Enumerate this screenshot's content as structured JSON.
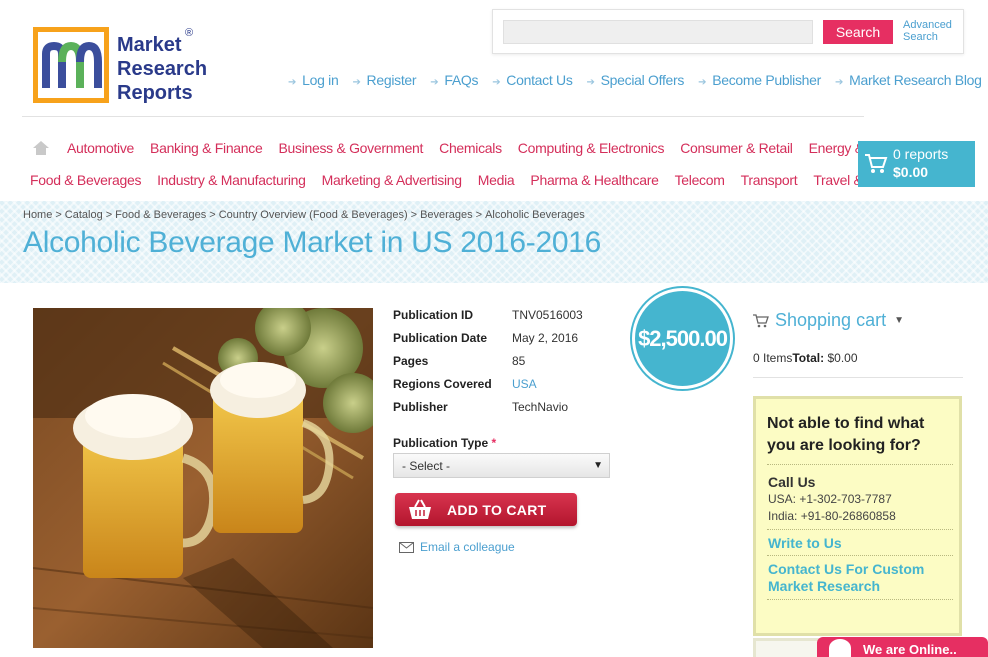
{
  "logo": {
    "line1": "Market",
    "line2": "Research",
    "line3": "Reports",
    "reg": "®"
  },
  "search": {
    "placeholder": "",
    "button_label": "Search",
    "advanced_line1": "Advanced",
    "advanced_line2": "Search"
  },
  "top_links": [
    "Log in",
    "Register",
    "FAQs",
    "Contact Us",
    "Special Offers",
    "Become Publisher",
    "Market Research Blog"
  ],
  "categories_row1": [
    "Automotive",
    "Banking & Finance",
    "Business & Government",
    "Chemicals",
    "Computing & Electronics",
    "Consumer & Retail",
    "Energy & Utilities"
  ],
  "categories_row2": [
    "Food & Beverages",
    "Industry & Manufacturing",
    "Marketing & Advertising",
    "Media",
    "Pharma & Healthcare",
    "Telecom",
    "Transport",
    "Travel & Leisure"
  ],
  "cart_button": {
    "count": "0 reports",
    "total": "$0.00"
  },
  "breadcrumb": [
    "Home",
    "Catalog",
    "Food & Beverages",
    "Country Overview (Food & Beverages)",
    "Beverages",
    "Alcoholic Beverages"
  ],
  "page_title": "Alcoholic Beverage Market in US 2016-2016",
  "details": [
    {
      "label": "Publication ID",
      "value": "TNV0516003"
    },
    {
      "label": "Publication Date",
      "value": "May 2, 2016"
    },
    {
      "label": "Pages",
      "value": "85"
    },
    {
      "label": "Regions Covered",
      "value": "USA"
    },
    {
      "label": "Publisher",
      "value": "TechNavio"
    }
  ],
  "price": "$2,500.00",
  "publication_type": {
    "label": "Publication Type",
    "required_mark": "*",
    "selected": "- Select -"
  },
  "add_to_cart_label": "ADD TO CART",
  "email_colleague_label": "Email a colleague",
  "shopping_cart": {
    "title": "Shopping cart",
    "items_text": "0 Items",
    "total_label": "Total:",
    "total_value": "$0.00"
  },
  "help": {
    "title": "Not able to find what you are looking for?",
    "call_label": "Call Us",
    "phone_usa": "USA: +1-302-703-7787",
    "phone_india": "India: +91-80-26860858",
    "write_label": "Write to Us",
    "contact_label": "Contact Us For Custom Market Research"
  },
  "online_label": "We are Online..",
  "colors": {
    "accent_pink": "#e62f62",
    "accent_blue": "#45b5cf",
    "link_blue": "#4b9fcf",
    "category_red": "#d42e5a",
    "help_bg": "#fcfcc4"
  }
}
